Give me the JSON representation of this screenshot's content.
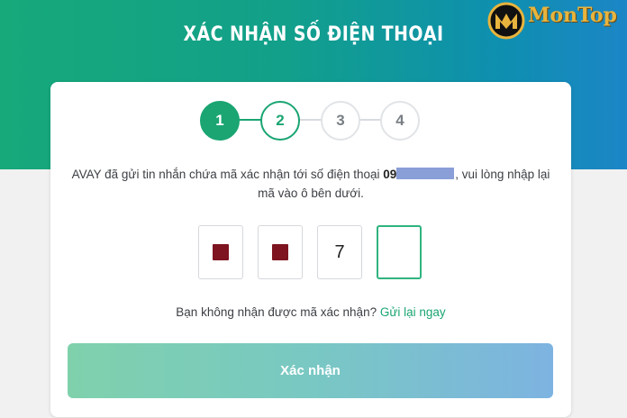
{
  "header": {
    "title": "XÁC NHẬN SỐ ĐIỆN THOẠI"
  },
  "logo": {
    "text": "MonTop",
    "colors": {
      "gold": "#e8b43d"
    }
  },
  "stepper": {
    "steps": [
      {
        "label": "1",
        "state": "completed"
      },
      {
        "label": "2",
        "state": "current"
      },
      {
        "label": "3",
        "state": "upcoming"
      },
      {
        "label": "4",
        "state": "upcoming"
      }
    ]
  },
  "message": {
    "prefix": "AVAY đã gửi tin nhắn chứa mã xác nhận tới số điện thoại",
    "phone_visible": "09",
    "suffix": ", vui lòng nhập lại mã vào ô bên dưới."
  },
  "otp": {
    "digits": [
      "",
      "",
      "7",
      ""
    ],
    "masked": [
      true,
      true,
      false,
      false
    ]
  },
  "resend": {
    "question": "Bạn không nhận được mã xác nhận?",
    "link": "Gửi lại ngay"
  },
  "confirm": {
    "label": "Xác nhận"
  },
  "colors": {
    "primary_green": "#1aa572",
    "header_gradient_start": "#17a97a",
    "header_gradient_end": "#1c86c6"
  }
}
